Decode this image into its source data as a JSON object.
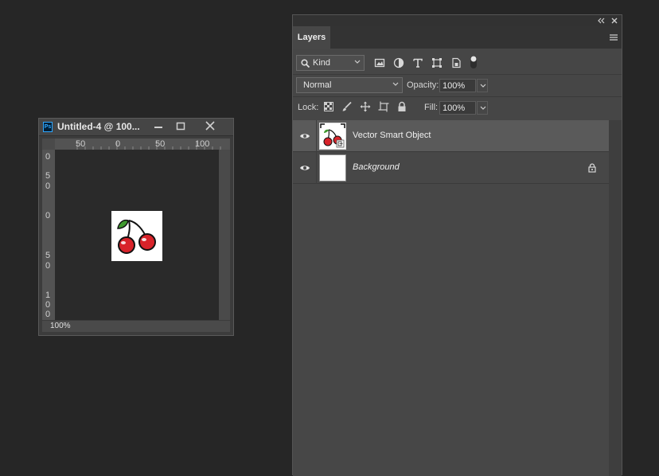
{
  "document": {
    "title": "Untitled-4 @ 100...",
    "ps_badge": "Ps",
    "zoom": "100%",
    "ruler_top": [
      "50",
      "0",
      "50",
      "100"
    ],
    "ruler_left": [
      "0",
      "5",
      "0",
      "0",
      "5",
      "0",
      "1",
      "0",
      "0"
    ],
    "icons": [
      "photoshop-icon",
      "minimize-icon",
      "maximize-icon",
      "close-icon"
    ]
  },
  "panel": {
    "tab": "Layers",
    "filter": {
      "kind": "Kind"
    },
    "blend_mode": "Normal",
    "opacity_label": "Opacity:",
    "opacity": "100%",
    "lock_label": "Lock:",
    "fill_label": "Fill:",
    "fill": "100%",
    "layers": [
      {
        "name": "Vector Smart Object",
        "visible": true,
        "selected": true,
        "italic": false
      },
      {
        "name": "Background",
        "visible": true,
        "selected": false,
        "italic": true,
        "locked": true
      }
    ]
  },
  "colors": {
    "workspace": "#262626",
    "panel": "#464646",
    "selected_row": "#5a5a5a",
    "cherry_red": "#d8232a",
    "leaf_green": "#3f9a2e"
  }
}
